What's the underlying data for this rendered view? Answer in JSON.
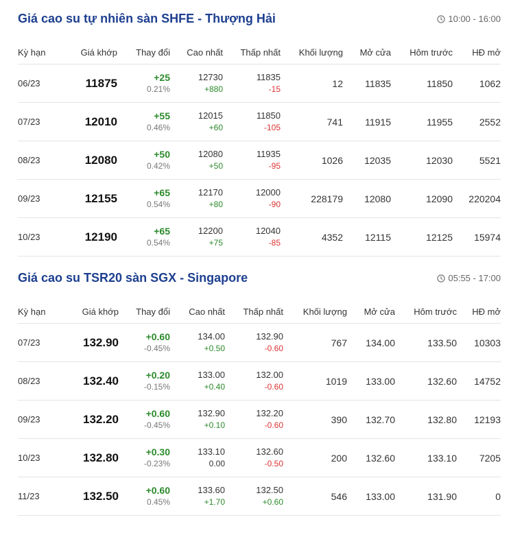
{
  "colors": {
    "title": "#1d3f8f",
    "up": "#2b8a2b",
    "down": "#dd3333"
  },
  "sections": [
    {
      "title": "Giá cao su tự nhiên sàn SHFE - Thượng Hải",
      "time": "10:00 - 16:00",
      "time_icon": "clock-icon",
      "headers": [
        "Kỳ hạn",
        "Giá khớp",
        "Thay đổi",
        "Cao nhất",
        "Thấp nhất",
        "Khối lượng",
        "Mở cửa",
        "Hôm trước",
        "HĐ mở"
      ],
      "rows": [
        {
          "term": "06/23",
          "price": "11875",
          "change": "+25",
          "change_pct": "0.21%",
          "high": "12730",
          "high_diff": "+880",
          "high_dir": "up",
          "low": "11835",
          "low_diff": "-15",
          "low_dir": "down",
          "volume": "12",
          "open": "11835",
          "prev": "11850",
          "oi": "1062"
        },
        {
          "term": "07/23",
          "price": "12010",
          "change": "+55",
          "change_pct": "0.46%",
          "high": "12015",
          "high_diff": "+60",
          "high_dir": "up",
          "low": "11850",
          "low_diff": "-105",
          "low_dir": "down",
          "volume": "741",
          "open": "11915",
          "prev": "11955",
          "oi": "2552"
        },
        {
          "term": "08/23",
          "price": "12080",
          "change": "+50",
          "change_pct": "0.42%",
          "high": "12080",
          "high_diff": "+50",
          "high_dir": "up",
          "low": "11935",
          "low_diff": "-95",
          "low_dir": "down",
          "volume": "1026",
          "open": "12035",
          "prev": "12030",
          "oi": "5521"
        },
        {
          "term": "09/23",
          "price": "12155",
          "change": "+65",
          "change_pct": "0.54%",
          "high": "12170",
          "high_diff": "+80",
          "high_dir": "up",
          "low": "12000",
          "low_diff": "-90",
          "low_dir": "down",
          "volume": "228179",
          "open": "12080",
          "prev": "12090",
          "oi": "220204"
        },
        {
          "term": "10/23",
          "price": "12190",
          "change": "+65",
          "change_pct": "0.54%",
          "high": "12200",
          "high_diff": "+75",
          "high_dir": "up",
          "low": "12040",
          "low_diff": "-85",
          "low_dir": "down",
          "volume": "4352",
          "open": "12115",
          "prev": "12125",
          "oi": "15974"
        }
      ]
    },
    {
      "title": "Giá cao su TSR20 sàn SGX - Singapore",
      "time": "05:55 - 17:00",
      "time_icon": "clock-icon",
      "headers": [
        "Kỳ hạn",
        "Giá khớp",
        "Thay đổi",
        "Cao nhất",
        "Thấp nhất",
        "Khối lượng",
        "Mở cửa",
        "Hôm trước",
        "HĐ mở"
      ],
      "rows": [
        {
          "term": "07/23",
          "price": "132.90",
          "change": "+0.60",
          "change_pct": "-0.45%",
          "high": "134.00",
          "high_diff": "+0.50",
          "high_dir": "up",
          "low": "132.90",
          "low_diff": "-0.60",
          "low_dir": "down",
          "volume": "767",
          "open": "134.00",
          "prev": "133.50",
          "oi": "10303"
        },
        {
          "term": "08/23",
          "price": "132.40",
          "change": "+0.20",
          "change_pct": "-0.15%",
          "high": "133.00",
          "high_diff": "+0.40",
          "high_dir": "up",
          "low": "132.00",
          "low_diff": "-0.60",
          "low_dir": "down",
          "volume": "1019",
          "open": "133.00",
          "prev": "132.60",
          "oi": "14752"
        },
        {
          "term": "09/23",
          "price": "132.20",
          "change": "+0.60",
          "change_pct": "-0.45%",
          "high": "132.90",
          "high_diff": "+0.10",
          "high_dir": "up",
          "low": "132.20",
          "low_diff": "-0.60",
          "low_dir": "down",
          "volume": "390",
          "open": "132.70",
          "prev": "132.80",
          "oi": "12193"
        },
        {
          "term": "10/23",
          "price": "132.80",
          "change": "+0.30",
          "change_pct": "-0.23%",
          "high": "133.10",
          "high_diff": "0.00",
          "high_dir": "zero",
          "low": "132.60",
          "low_diff": "-0.50",
          "low_dir": "down",
          "volume": "200",
          "open": "132.60",
          "prev": "133.10",
          "oi": "7205"
        },
        {
          "term": "11/23",
          "price": "132.50",
          "change": "+0.60",
          "change_pct": "0.45%",
          "high": "133.60",
          "high_diff": "+1.70",
          "high_dir": "up",
          "low": "132.50",
          "low_diff": "+0.60",
          "low_dir": "up",
          "volume": "546",
          "open": "133.00",
          "prev": "131.90",
          "oi": "0"
        }
      ]
    }
  ]
}
